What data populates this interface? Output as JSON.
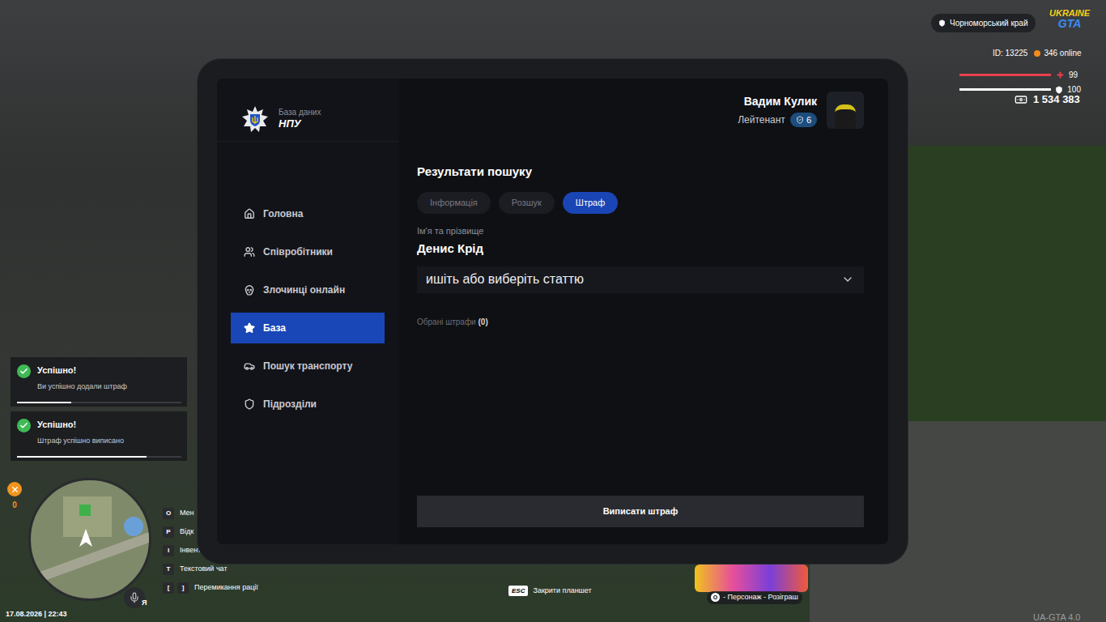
{
  "hud": {
    "region": "Чорноморський край",
    "logo": [
      "UKRAINE",
      "GTA"
    ],
    "player_id": "ID: 13225",
    "online": "346 online",
    "health": {
      "value": "99",
      "level": 0.99
    },
    "armor": {
      "value": "100",
      "level": 1
    },
    "money": "1 534 383",
    "coins": "0",
    "datetime": "17.08.2026 | 22:43",
    "voice_key": "Я",
    "version": "UA-GTA 4.0"
  },
  "notifications": [
    {
      "title": "Успішно!",
      "message": "Ви успішно додали штраф",
      "level": 0.33
    },
    {
      "title": "Успішно!",
      "message": "Штраф успішно виписано",
      "level": 0.79
    }
  ],
  "key_hints": [
    {
      "keys": [
        "O"
      ],
      "label": "Мен"
    },
    {
      "keys": [
        "P"
      ],
      "label": "Відк"
    },
    {
      "keys": [
        "I"
      ],
      "label": "Інвент"
    },
    {
      "keys": [
        "T"
      ],
      "label": "Текстовий чат"
    },
    {
      "keys": [
        "[",
        "]"
      ],
      "label": "Перемикання рації"
    }
  ],
  "close_hint": {
    "key": "ESC",
    "label": "Закрити планшет"
  },
  "promo": {
    "key": "O",
    "label": "- Персонаж - Розіграш"
  },
  "tablet": {
    "app": {
      "subtitle": "База даних",
      "title": "НПУ"
    },
    "user": {
      "name": "Вадим Кулик",
      "rank": "Лейтенант",
      "level": "6"
    },
    "sidebar": {
      "items": [
        {
          "label": "Головна",
          "selected": false
        },
        {
          "label": "Співробітники",
          "selected": false
        },
        {
          "label": "Злочинці онлайн",
          "selected": false
        },
        {
          "label": "База",
          "selected": true
        },
        {
          "label": "Пошук транспорту",
          "selected": false
        },
        {
          "label": "Підрозділи",
          "selected": false
        }
      ]
    },
    "results": {
      "title": "Результати пошуку",
      "tabs": [
        {
          "label": "Інформація",
          "selected": false
        },
        {
          "label": "Розшук",
          "selected": false
        },
        {
          "label": "Штраф",
          "selected": true
        }
      ],
      "name_label": "Ім'я та прізвище",
      "name": "Денис Крід",
      "article_select": {
        "placeholder": "ишіть або виберіть статтю",
        "expanded": false
      },
      "selected_fines": {
        "label": "Обрані штрафи",
        "count": "(0)"
      },
      "submit_button": "Виписати штраф"
    }
  }
}
